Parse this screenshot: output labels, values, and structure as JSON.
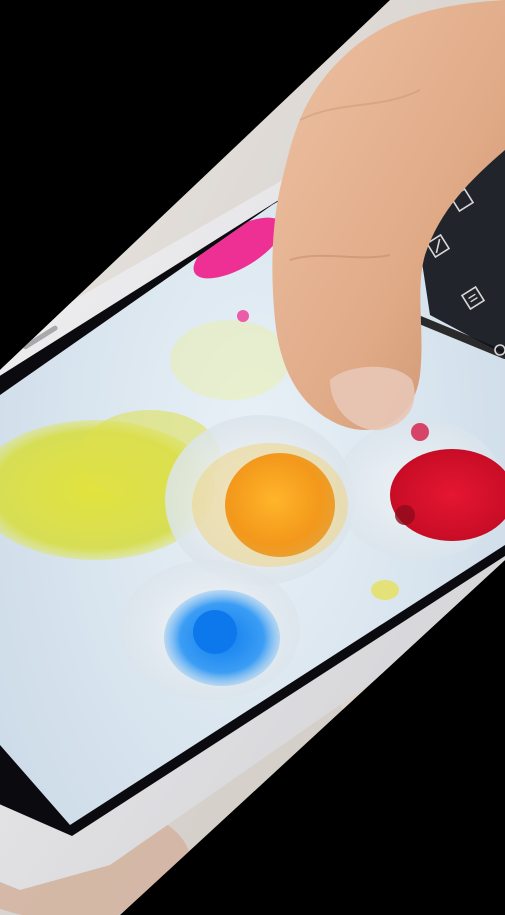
{
  "scene": {
    "description_visible_text": "",
    "colors": {
      "background": "#000000",
      "phone_body": "#e4e4e6",
      "phone_bezel": "#0c0c10",
      "screen_base": "#dbe6ef",
      "paint_yellow": "#dbe04a",
      "paint_orange": "#f5a320",
      "paint_red": "#d8122e",
      "paint_pink": "#f03c9a",
      "paint_blue": "#1e8ff0",
      "skin": "#e7b595"
    },
    "icons": [
      "crop-icon",
      "edit-icon",
      "save-icon",
      "share-icon"
    ]
  }
}
